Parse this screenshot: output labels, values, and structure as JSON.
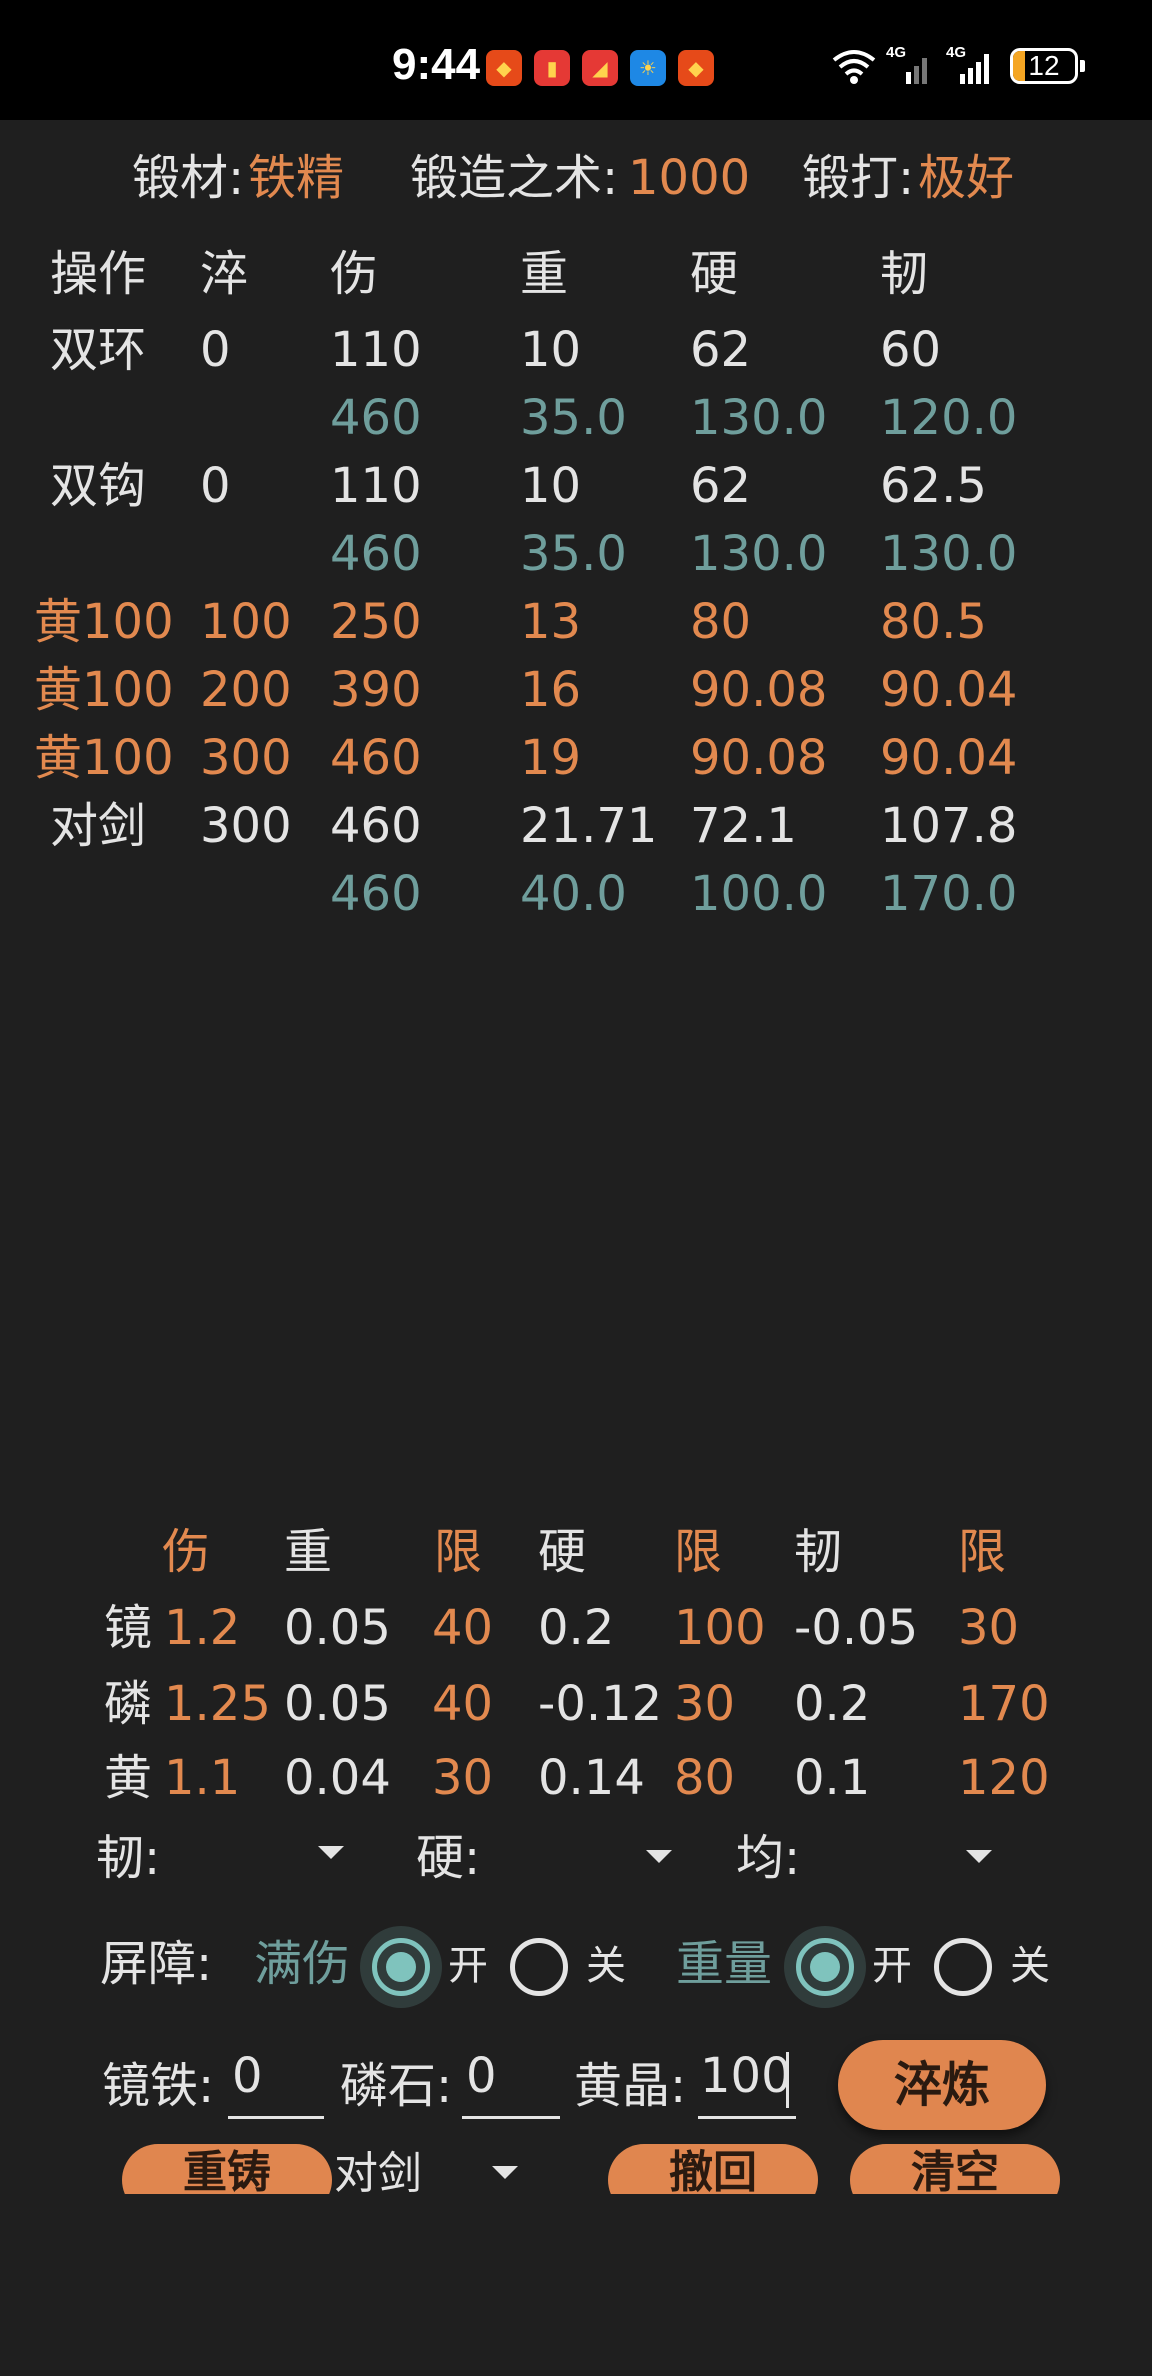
{
  "status_bar": {
    "time": "9:44",
    "notification_icons": [
      "notification-app-icon-1",
      "notification-app-icon-2",
      "notification-app-icon-3",
      "weather-app-icon",
      "notification-app-icon-4"
    ],
    "network": [
      "wifi-icon",
      "4g-signal-icon",
      "4g-signal-icon"
    ],
    "network_label_1": "4G",
    "network_label_2": "4G",
    "battery_level": "12"
  },
  "colors": {
    "accent_orange": "#e2894f",
    "teal": "#6f9e9c",
    "button": "#e0864f",
    "background": "#1f1f1f"
  },
  "header": {
    "material_label": "锻材:",
    "material_value": "铁精",
    "skill_label": "锻造之术:",
    "skill_value": "1000",
    "strike_label": "锻打:",
    "strike_value": "极好"
  },
  "table": {
    "columns": [
      "操作",
      "淬",
      "伤",
      "重",
      "硬",
      "韧"
    ],
    "rows": [
      {
        "style": "white",
        "cells": [
          "双环",
          "0",
          "110",
          "10",
          "62",
          "60"
        ]
      },
      {
        "style": "teal",
        "cells": [
          "",
          "",
          "460",
          "35.0",
          "130.0",
          "120.0"
        ]
      },
      {
        "style": "white",
        "cells": [
          "双钩",
          "0",
          "110",
          "10",
          "62",
          "62.5"
        ]
      },
      {
        "style": "teal",
        "cells": [
          "",
          "",
          "460",
          "35.0",
          "130.0",
          "130.0"
        ]
      },
      {
        "style": "orange",
        "cells": [
          "黄100",
          "100",
          "250",
          "13",
          "80",
          "80.5"
        ]
      },
      {
        "style": "orange",
        "cells": [
          "黄100",
          "200",
          "390",
          "16",
          "90.08",
          "90.04"
        ]
      },
      {
        "style": "orange",
        "cells": [
          "黄100",
          "300",
          "460",
          "19",
          "90.08",
          "90.04"
        ]
      },
      {
        "style": "white",
        "cells": [
          "对剑",
          "300",
          "460",
          "21.71",
          "72.1",
          "107.8"
        ]
      },
      {
        "style": "teal",
        "cells": [
          "",
          "",
          "460",
          "40.0",
          "100.0",
          "170.0"
        ]
      }
    ]
  },
  "coef_table": {
    "headers": [
      "伤",
      "重",
      "限",
      "硬",
      "限",
      "韧",
      "限"
    ],
    "rows": [
      {
        "label": "镜",
        "values": [
          "1.2",
          "0.05",
          "40",
          "0.2",
          "100",
          "-0.05",
          "30"
        ]
      },
      {
        "label": "磷",
        "values": [
          "1.25",
          "0.05",
          "40",
          "-0.12",
          "30",
          "0.2",
          "170"
        ]
      },
      {
        "label": "黄",
        "values": [
          "1.1",
          "0.04",
          "30",
          "0.14",
          "80",
          "0.1",
          "120"
        ]
      }
    ]
  },
  "selectors": {
    "toughness_label": "韧:",
    "hardness_label": "硬:",
    "balance_label": "均:"
  },
  "barrier": {
    "label": "屏障:",
    "full_damage_label": "满伤",
    "weight_label": "重量",
    "on_label": "开",
    "off_label": "关",
    "full_damage_on": true,
    "weight_on": true
  },
  "inputs": {
    "mirror_iron_label": "镜铁:",
    "mirror_iron_value": "0",
    "phosphor_label": "磷石:",
    "phosphor_value": "0",
    "yellow_crystal_label": "黄晶:",
    "yellow_crystal_value": "100"
  },
  "buttons": {
    "quench": "淬炼",
    "recast": "重铸",
    "undo": "撤回",
    "clear": "清空"
  },
  "weapon_select": {
    "selected": "对剑"
  }
}
